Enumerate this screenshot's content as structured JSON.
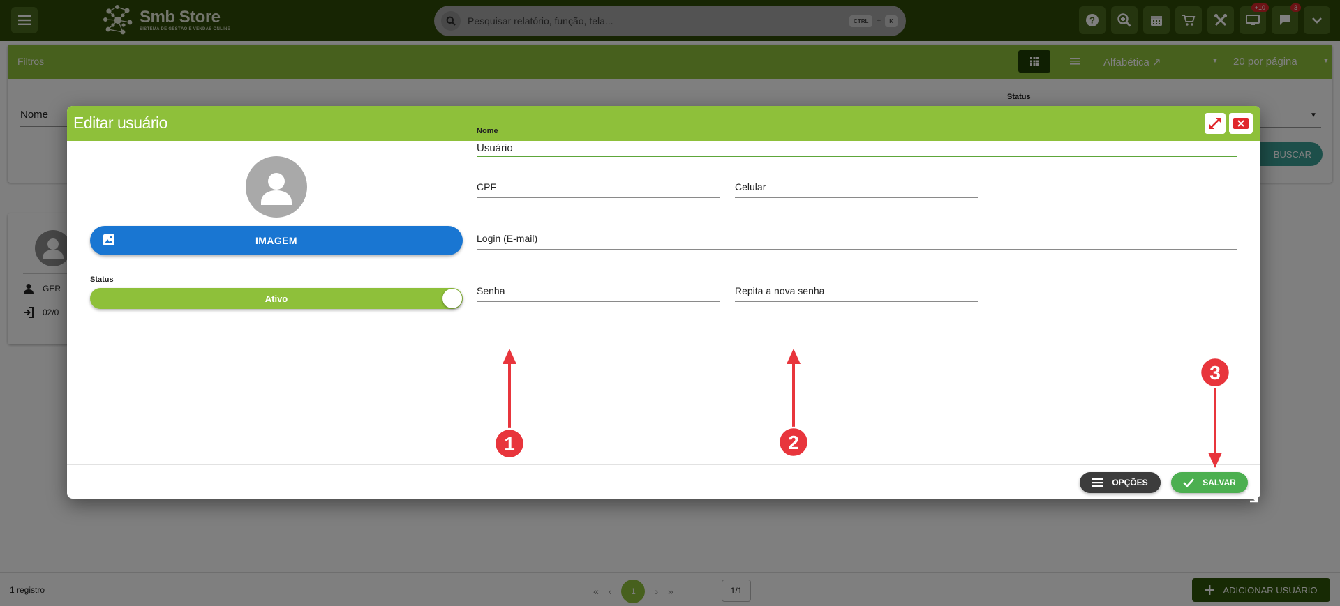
{
  "app": {
    "brand_name": "Smb Store",
    "brand_tagline": "SISTEMA DE GESTÃO E VENDAS ONLINE",
    "search_placeholder": "Pesquisar relatório, função, tela...",
    "shortcut_ctrl": "CTRL",
    "shortcut_plus": "+",
    "shortcut_key": "K",
    "badges": {
      "monitor": "+10",
      "chat": "3"
    },
    "icons": [
      "menu-icon",
      "help-icon",
      "zoom-icon",
      "calendar-icon",
      "cart-icon",
      "tools-icon",
      "monitor-icon",
      "chat-icon",
      "chevron-down-icon"
    ]
  },
  "filters": {
    "title": "Filtros",
    "order": "Alfabética ↗",
    "per_page": "20 por página",
    "name_label": "Nome",
    "status_label": "Status",
    "search_button": "BUSCAR"
  },
  "user_card": {
    "role": "GER",
    "date": "02/0"
  },
  "footer": {
    "count": "1 registro",
    "current_page": "1",
    "page_box": "1/1",
    "add_button": "ADICIONAR USUÁRIO"
  },
  "modal": {
    "title": "Editar usuário",
    "image_button": "IMAGEM",
    "status_label": "Status",
    "status_value": "Ativo",
    "fields": {
      "nome_label": "Nome",
      "nome_value": "Usuário",
      "cpf": "CPF",
      "celular": "Celular",
      "login": "Login (E-mail)",
      "senha": "Senha",
      "repita_senha": "Repita a nova senha"
    },
    "options_button": "OPÇÕES",
    "save_button": "SALVAR"
  },
  "annotations": {
    "markers": [
      "1",
      "2",
      "3"
    ],
    "color": "#e8353c"
  },
  "colors": {
    "topbar": "#2e4a06",
    "accent_green": "#8ec03a",
    "primary_blue": "#1976d2",
    "save_green": "#4caf50",
    "buscar_teal": "#3a9f95"
  }
}
